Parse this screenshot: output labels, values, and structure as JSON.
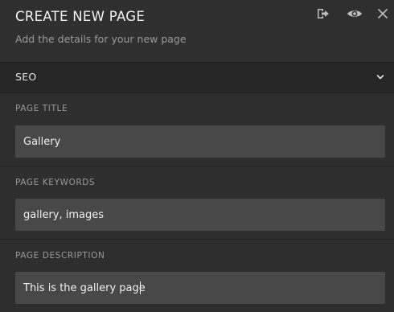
{
  "header": {
    "title": "CREATE NEW PAGE",
    "subtitle": "Add the details for your new page",
    "icons": [
      "exit-icon",
      "eye-icon",
      "close-icon"
    ]
  },
  "section": {
    "label": "SEO",
    "expanded": true,
    "chevron_icon": "chevron-down-icon"
  },
  "fields": {
    "title": {
      "label": "PAGE TITLE",
      "value": "Gallery"
    },
    "keywords": {
      "label": "PAGE KEYWORDS",
      "value": "gallery, images"
    },
    "description": {
      "label": "PAGE DESCRIPTION",
      "value": "This is the gallery page"
    }
  },
  "colors": {
    "background": "#2e2e2e",
    "section_bar": "#262626",
    "input_background": "#484848",
    "text_primary": "#f2f2f2",
    "text_secondary": "#9a9a9a"
  }
}
